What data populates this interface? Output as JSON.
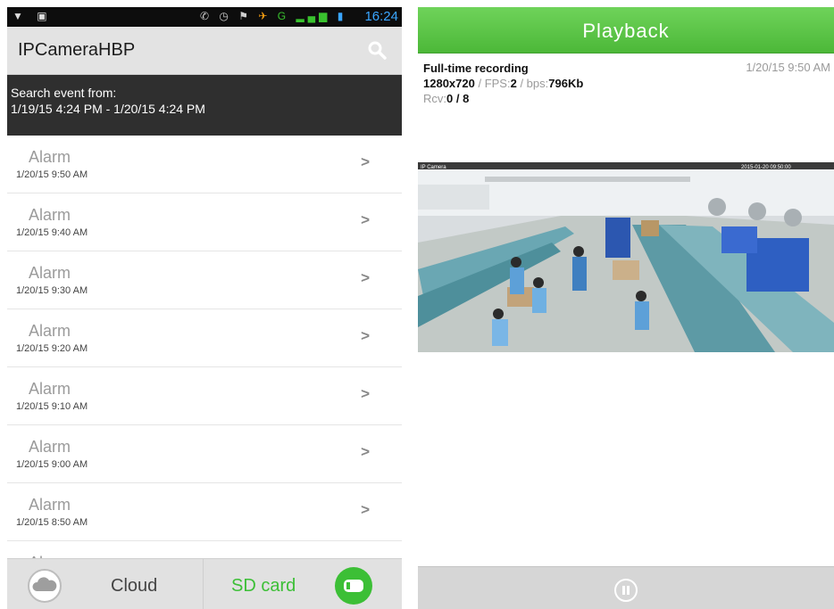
{
  "left": {
    "status": {
      "time": "16:24",
      "net": "G"
    },
    "title": "IPCameraHBP",
    "search_label": "Search event from:",
    "search_range": "1/19/15 4:24 PM - 1/20/15 4:24 PM",
    "events": [
      {
        "title": "Alarm",
        "time": "1/20/15 9:50 AM"
      },
      {
        "title": "Alarm",
        "time": "1/20/15 9:40 AM"
      },
      {
        "title": "Alarm",
        "time": "1/20/15 9:30 AM"
      },
      {
        "title": "Alarm",
        "time": "1/20/15 9:20 AM"
      },
      {
        "title": "Alarm",
        "time": "1/20/15 9:10 AM"
      },
      {
        "title": "Alarm",
        "time": "1/20/15 9:00 AM"
      },
      {
        "title": "Alarm",
        "time": "1/20/15 8:50 AM"
      },
      {
        "title": "Alarm",
        "time": ""
      }
    ],
    "chevron": ">",
    "tabs": {
      "cloud": "Cloud",
      "sd": "SD card"
    },
    "icons": {
      "search": "search-icon",
      "cloud": "cloud-icon",
      "sd": "sd-card-icon"
    }
  },
  "right": {
    "title": "Playback",
    "mode": "Full-time recording",
    "timestamp": "1/20/15 9:50 AM",
    "resolution": "1280x720",
    "fps_label": "FPS:",
    "fps": "2",
    "bps_label": "bps:",
    "bps": "796Kb",
    "rcv_label": "Rcv:",
    "rcv": "0 / 8",
    "sep": " / ",
    "overlay_left": "IP Camera",
    "overlay_right": "2015-01-20 09:50:00",
    "icons": {
      "pause": "pause-icon"
    }
  },
  "colors": {
    "accent_green": "#4cb838",
    "header_dark": "#2f2f2f",
    "time_blue": "#3aa6ff"
  }
}
